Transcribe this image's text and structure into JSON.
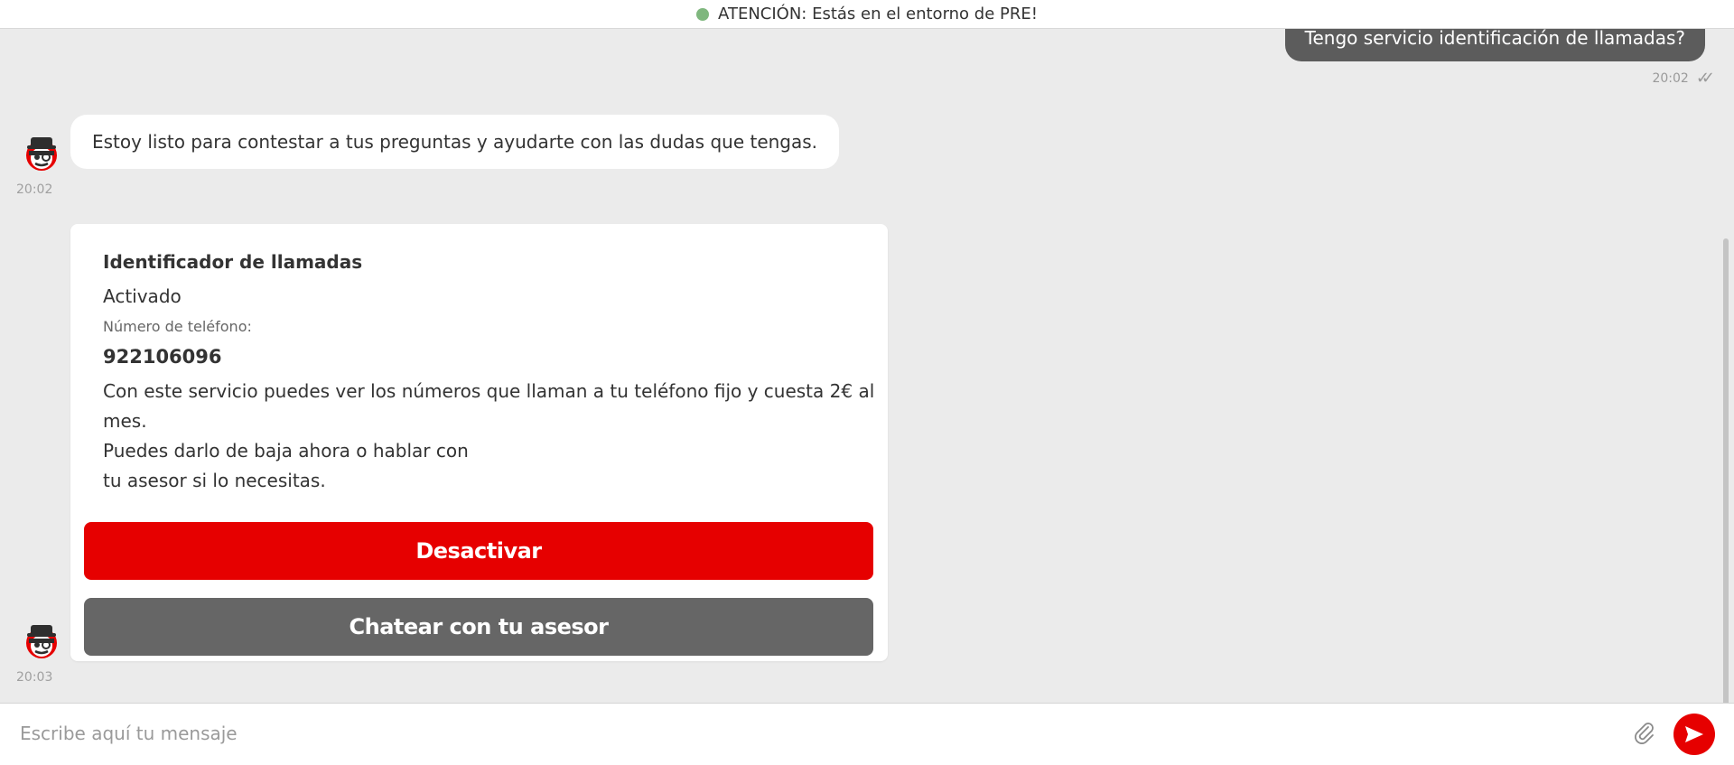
{
  "banner": {
    "text": "ATENCIÓN: Estás en el entorno de PRE!",
    "dot_color": "#7fb77e"
  },
  "messages": {
    "user_question": "Tengo servicio identificación de llamadas?",
    "user_time": "20:02",
    "bot_greeting": "Estoy listo para contestar a tus preguntas y ayudarte con las dudas que tengas.",
    "bot_greeting_time": "20:02",
    "card_time": "20:03"
  },
  "card": {
    "title": "Identificador de llamadas",
    "status": "Activado",
    "phone_label": "Número de teléfono:",
    "phone_number": "922106096",
    "description": "Con este servicio puedes ver los números que llaman a tu teléfono fijo y cuesta 2€ al mes.\nPuedes darlo de baja ahora o hablar con\n tu asesor si lo necesitas.",
    "primary_button": "Desactivar",
    "secondary_button": "Chatear con tu asesor"
  },
  "input": {
    "placeholder": "Escribe aquí tu mensaje"
  },
  "icons": {
    "avatar": "bot-avatar-icon",
    "read_receipt": "double-check-icon",
    "attach": "paperclip-icon",
    "send": "send-icon"
  },
  "colors": {
    "brand_red": "#e60000",
    "user_bubble": "#5c5c5c",
    "secondary_button": "#666666",
    "background": "#ebebeb"
  }
}
